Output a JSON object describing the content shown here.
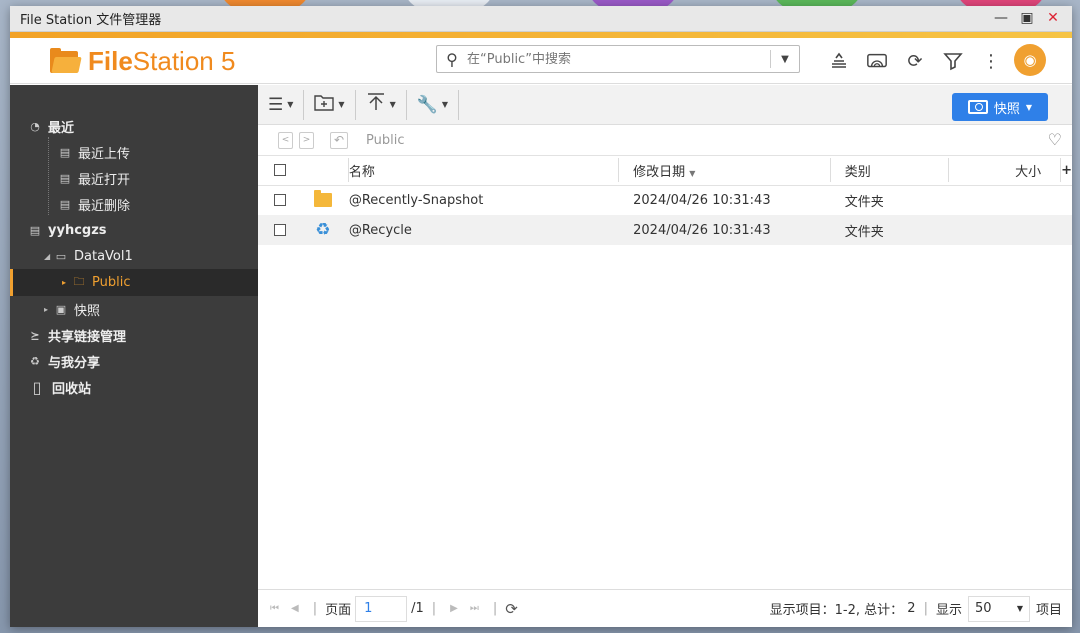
{
  "window": {
    "title": "File Station 文件管理器",
    "minimize_icon": "minimize-icon",
    "maximize_icon": "maximize-icon",
    "close_icon": "close-icon"
  },
  "header": {
    "logo_bold": "File",
    "logo_rest": "Station 5",
    "search_placeholder": "在“Public”中搜索",
    "icons": [
      "stack-icon",
      "cast-icon",
      "refresh-icon",
      "filter-icon",
      "more-vert-icon"
    ],
    "avatar_icon": "user-badge-icon"
  },
  "sidebar": {
    "recent": "最近",
    "recent_upload": "最近上传",
    "recent_open": "最近打开",
    "recent_delete": "最近删除",
    "host": "yyhcgzs",
    "volume": "DataVol1",
    "public": "Public",
    "snapshot": "快照",
    "share_links": "共享链接管理",
    "shared_with_me": "与我分享",
    "recycle_bin": "回收站"
  },
  "toolbar": {
    "snapshot_label": "快照"
  },
  "pathbar": {
    "path": "Public"
  },
  "table": {
    "headers": {
      "name": "名称",
      "modified": "修改日期",
      "type": "类别",
      "size": "大小",
      "add": "+"
    },
    "rows": [
      {
        "name": "@Recently-Snapshot",
        "modified": "2024/04/26 10:31:43",
        "type": "文件夹",
        "size": ""
      },
      {
        "name": "@Recycle",
        "modified": "2024/04/26 10:31:43",
        "type": "文件夹",
        "size": ""
      }
    ]
  },
  "status": {
    "page_label": "页面",
    "page_value": "1",
    "page_total": "/1",
    "items_label": "显示项目：",
    "items_range": "1-2, 总计：",
    "items_total": "2",
    "display_label": "显示",
    "per_page": "50",
    "per_page_suffix": "项目"
  },
  "colors": {
    "accent": "#f0a030",
    "primary": "#2f80e8",
    "sidebar_bg": "#3c3c3c"
  }
}
